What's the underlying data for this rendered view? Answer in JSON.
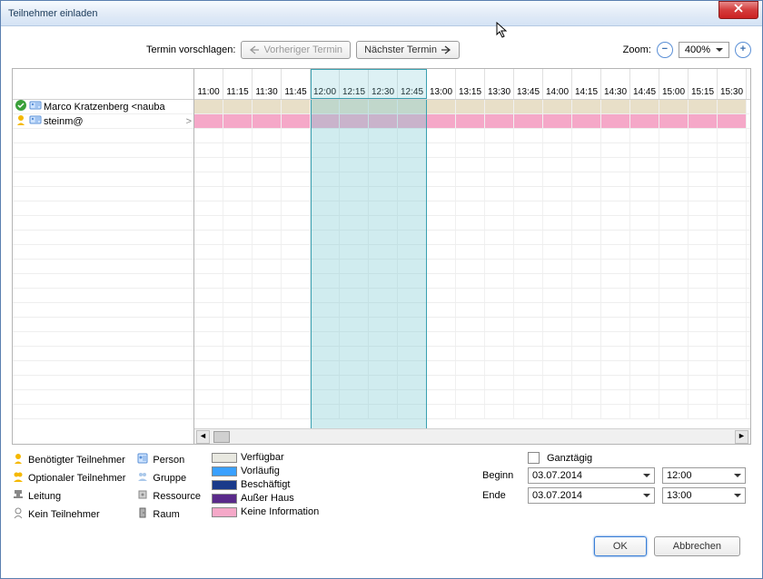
{
  "window": {
    "title": "Teilnehmer einladen"
  },
  "toolbar": {
    "suggest_label": "Termin vorschlagen:",
    "prev_label": "Vorheriger Termin",
    "next_label": "Nächster Termin",
    "zoom_label": "Zoom:",
    "zoom_value": "400%"
  },
  "time_slots": [
    "11:00",
    "11:15",
    "11:30",
    "11:45",
    "12:00",
    "12:15",
    "12:30",
    "12:45",
    "13:00",
    "13:15",
    "13:30",
    "13:45",
    "14:00",
    "14:15",
    "14:30",
    "14:45",
    "15:00",
    "15:15",
    "15:30"
  ],
  "attendees": [
    {
      "status": "accepted",
      "type": "required",
      "name": "Marco Kratzenberg <nauba"
    },
    {
      "status": "unknown",
      "type": "required",
      "name": "steinm@"
    }
  ],
  "selection": {
    "start_index": 4,
    "end_index": 8
  },
  "legend": {
    "roles": [
      {
        "icon": "required",
        "label": "Benötigter Teilnehmer"
      },
      {
        "icon": "optional",
        "label": "Optionaler Teilnehmer"
      },
      {
        "icon": "chair",
        "label": "Leitung"
      },
      {
        "icon": "none",
        "label": "Kein Teilnehmer"
      }
    ],
    "types": [
      {
        "icon": "person",
        "label": "Person"
      },
      {
        "icon": "group",
        "label": "Gruppe"
      },
      {
        "icon": "resource",
        "label": "Ressource"
      },
      {
        "icon": "room",
        "label": "Raum"
      }
    ],
    "status": [
      {
        "class": "verfugbar",
        "label": "Verfügbar"
      },
      {
        "class": "vorlaufig",
        "label": "Vorläufig"
      },
      {
        "class": "beschaftigt",
        "label": "Beschäftigt"
      },
      {
        "class": "ausserhaus",
        "label": "Außer Haus"
      },
      {
        "class": "keine",
        "label": "Keine Information"
      }
    ]
  },
  "allday": {
    "label": "Ganztägig",
    "checked": false
  },
  "begin": {
    "label": "Beginn",
    "date": "03.07.2014",
    "time": "12:00"
  },
  "end": {
    "label": "Ende",
    "date": "03.07.2014",
    "time": "13:00"
  },
  "footer": {
    "ok": "OK",
    "cancel": "Abbrechen"
  }
}
